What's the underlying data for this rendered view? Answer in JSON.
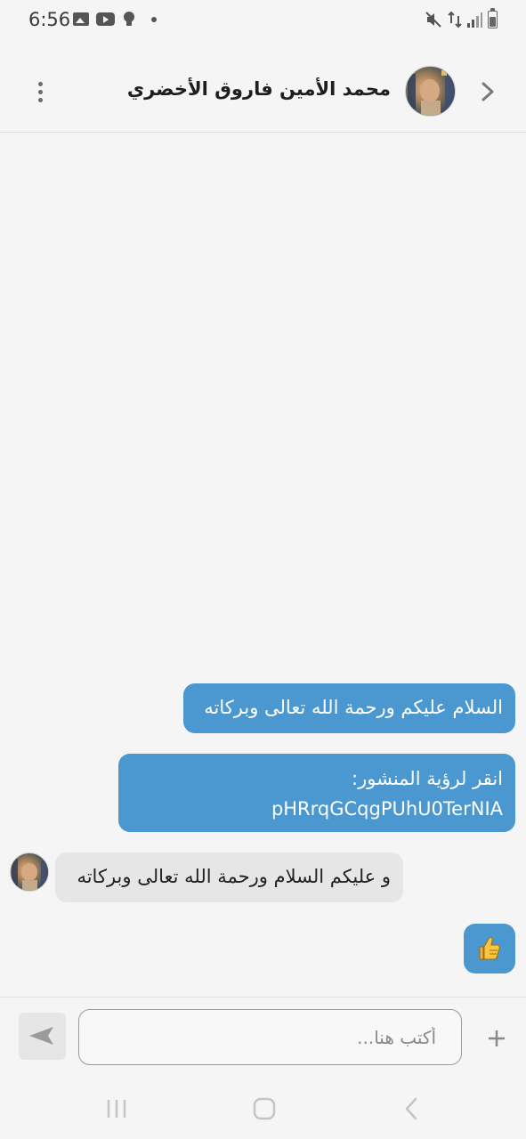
{
  "status_bar": {
    "time": "6:56",
    "left_icons": [
      "gallery-icon",
      "youtube-icon",
      "bulb-icon",
      "dot-icon"
    ],
    "right_icons": [
      "mute-icon",
      "data-icon",
      "signal-icon",
      "battery-icon"
    ]
  },
  "header": {
    "contact_name": "محمد الأمين فاروق  الأخضري",
    "menu_icon": "more-vertical-icon",
    "back_icon": "chevron-right-icon"
  },
  "messages": [
    {
      "direction": "out",
      "text": "السلام عليكم ورحمة الله تعالى وبركاته"
    },
    {
      "direction": "out",
      "text_line1": "انقر لرؤية المنشور:",
      "text_line2": "pHRrqGCqgPUhU0TerNIA"
    },
    {
      "direction": "in",
      "text": "و عليكم السلام ورحمة الله تعالى وبركاته"
    },
    {
      "direction": "out",
      "emoji": "thumbs-up-icon"
    }
  ],
  "composer": {
    "placeholder": "أكتب هنا...",
    "send_icon": "send-icon",
    "attach_icon": "plus-icon"
  },
  "nav_bar": {
    "icons": [
      "recents-icon",
      "home-icon",
      "back-icon"
    ]
  },
  "colors": {
    "outgoing_bubble": "#4a98cf",
    "incoming_bubble": "#e6e6e6",
    "background": "#f5f5f5"
  }
}
